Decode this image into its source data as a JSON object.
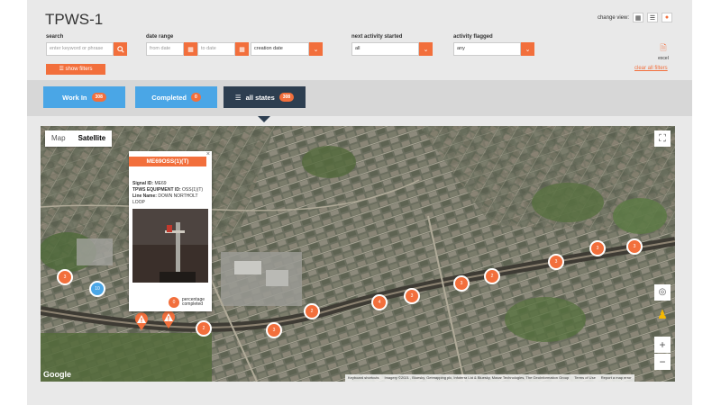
{
  "page": {
    "title": "TPWS-1"
  },
  "change_view": {
    "label": "change view:",
    "icons": [
      "grid-icon",
      "list-icon",
      "map-pin-icon"
    ]
  },
  "filters": {
    "search": {
      "label": "search",
      "placeholder": "enter keyword or phrase"
    },
    "date_range": {
      "label": "date range",
      "from_placeholder": "from date",
      "to_placeholder": "to date",
      "type_value": "creation date"
    },
    "next_activity": {
      "label": "next activity started",
      "value": "all"
    },
    "activity_flagged": {
      "label": "activity flagged",
      "value": "any"
    },
    "excel_label": "excel",
    "show_filters": "show filters",
    "clear_all": "clear all filters"
  },
  "tabs": [
    {
      "label": "Work In",
      "count": "308"
    },
    {
      "label": "Completed",
      "count": "0"
    },
    {
      "label": "all states",
      "count": "308"
    }
  ],
  "map": {
    "type_buttons": [
      "Map",
      "Satellite"
    ],
    "active_type": "Satellite",
    "google_label": "Google",
    "attribution": [
      "Keyboard shortcuts",
      "Imagery ©2021 , Bluesky, Getmapping plc, Infoterra Ltd & Bluesky, Maxar Technologies, The GeoInformation Group",
      "Terms of Use",
      "Report a map error"
    ],
    "clusters": [
      "3",
      "10",
      "2",
      "3",
      "2",
      "4",
      "3",
      "3",
      "2",
      "3",
      "3",
      "3",
      "2"
    ],
    "colors": {
      "accent": "#f26f3c",
      "blue": "#4aa6e6",
      "dark": "#2d3e50"
    }
  },
  "popup": {
    "title": "ME69OSS(1)(T)",
    "signal_label": "Signal ID:",
    "signal_value": "ME69",
    "equipment_label": "TPWS EQUIPMENT ID:",
    "equipment_value": "OSS(1)(T)",
    "line_label": "Line Name:",
    "line_value": "DOWN NORTHOLT LOOP",
    "percent": "0",
    "percent_label_1": "percentage",
    "percent_label_2": "completed"
  }
}
